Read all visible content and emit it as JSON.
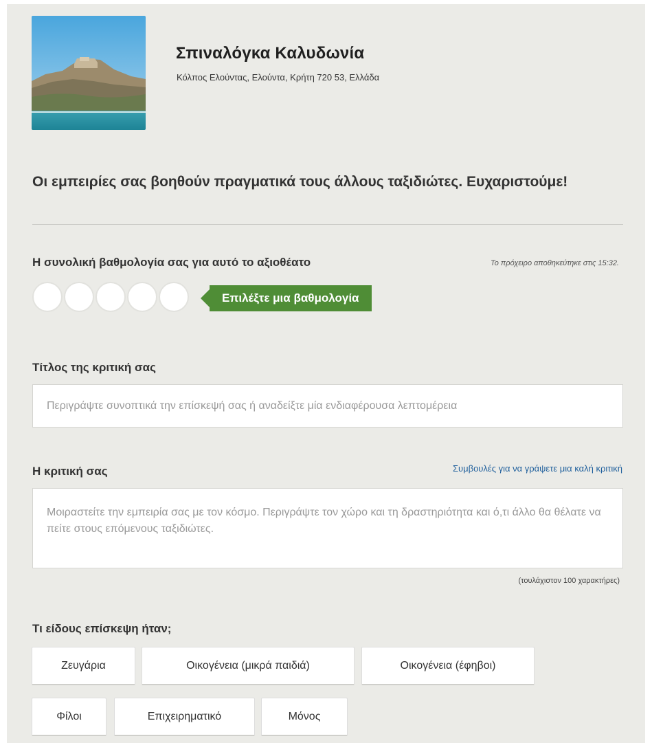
{
  "place": {
    "name": "Σπιναλόγκα Καλυδωνία",
    "address": "Κόλπος Ελούντας, Ελούντα, Κρήτη 720 53, Ελλάδα",
    "photo_icon": "fortress-island-photo"
  },
  "thanks_message": "Οι εμπειρίες σας βοηθούν πραγματικά τους άλλους ταξιδιώτες. Ευχαριστούμε!",
  "rating": {
    "label": "Η συνολική βαθμολογία σας για αυτό το αξιοθέατο",
    "draft_note": "Το πρόχειρο αποθηκεύτηκε στις 15:32.",
    "bubble_count": 5,
    "selected": 0,
    "prompt": "Επιλέξτε μια βαθμολογία",
    "prompt_color": "#4f8d36"
  },
  "title_field": {
    "label": "Τίτλος της κριτική σας",
    "placeholder": "Περιγράψτε συνοπτικά την επίσκεψή σας ή αναδείξτε μία ενδιαφέρουσα λεπτομέρεια",
    "value": ""
  },
  "review_field": {
    "label": "Η κριτική σας",
    "tips_link": "Συμβουλές για να γράψετε μια καλή κριτική",
    "placeholder": "Μοιραστείτε την εμπειρία σας με τον κόσμο. Περιγράψτε τον χώρο και τη δραστηριότητα και ό,τι άλλο θα θέλατε να πείτε στους επόμενους ταξιδιώτες.",
    "value": "",
    "min_chars_note": "(τουλάχιστον 100 χαρακτήρες)"
  },
  "trip_type": {
    "label": "Τι είδους επίσκεψη ήταν;",
    "options": [
      "Ζευγάρια",
      "Οικογένεια (μικρά παιδιά)",
      "Οικογένεια (έφηβοι)",
      "Φίλοι",
      "Επιχειρηματικό",
      "Μόνος"
    ]
  }
}
